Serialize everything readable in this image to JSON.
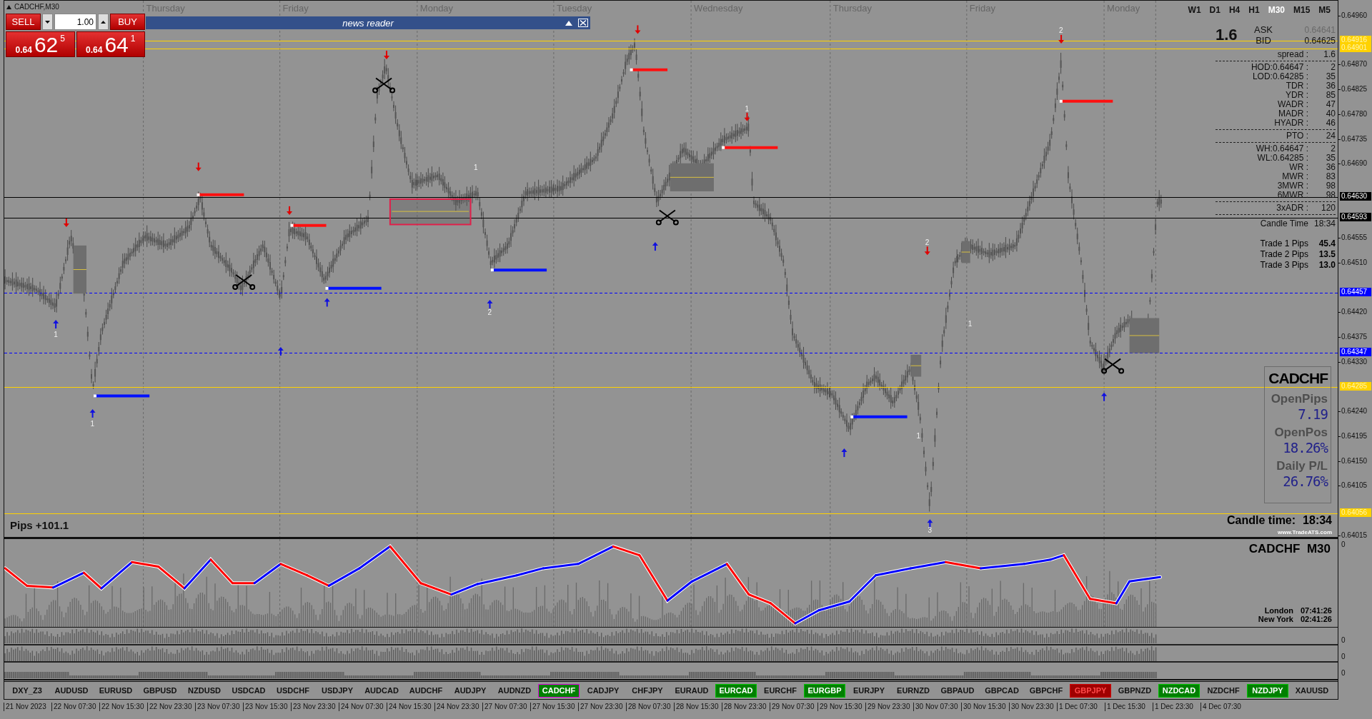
{
  "chart_header": {
    "title": "CADCHF,M30"
  },
  "trade_panel": {
    "sell_label": "SELL",
    "buy_label": "BUY",
    "lot_size": "1.00",
    "sell_price": {
      "prefix": "0.64",
      "big": "62",
      "small": "5"
    },
    "buy_price": {
      "prefix": "0.64",
      "big": "64",
      "small": "1"
    }
  },
  "news_reader": {
    "title": "news reader"
  },
  "day_labels": [
    "Thursday",
    "Friday",
    "Monday",
    "Tuesday",
    "Wednesday",
    "Thursday",
    "Friday",
    "Monday"
  ],
  "timeframes": [
    {
      "label": "W1",
      "selected": false
    },
    {
      "label": "D1",
      "selected": false
    },
    {
      "label": "H4",
      "selected": false
    },
    {
      "label": "H1",
      "selected": false
    },
    {
      "label": "M30",
      "selected": true
    },
    {
      "label": "M15",
      "selected": false
    },
    {
      "label": "M5",
      "selected": false
    }
  ],
  "info_panel": {
    "spread_large": "1.6",
    "ask_label": "ASK",
    "ask": "0.64641",
    "bid_label": "BID",
    "bid": "0.64625",
    "rows": [
      {
        "label": "spread :",
        "value": "1.6",
        "divider_after": true
      },
      {
        "label": "HOD:0.64647 :",
        "value": "2",
        "divider_after": false
      },
      {
        "label": "LOD:0.64285 :",
        "value": "35",
        "divider_after": false
      },
      {
        "label": "TDR :",
        "value": "36",
        "divider_after": false
      },
      {
        "label": "YDR :",
        "value": "85",
        "divider_after": false
      },
      {
        "label": "WADR :",
        "value": "47",
        "divider_after": false
      },
      {
        "label": "MADR :",
        "value": "40",
        "divider_after": false
      },
      {
        "label": "HYADR :",
        "value": "46",
        "divider_after": true
      },
      {
        "label": "PTO :",
        "value": "24",
        "divider_after": true
      },
      {
        "label": "WH:0.64647 :",
        "value": "2",
        "divider_after": false
      },
      {
        "label": "WL:0.64285 :",
        "value": "35",
        "divider_after": false
      },
      {
        "label": "WR :",
        "value": "36",
        "divider_after": false
      },
      {
        "label": "MWR :",
        "value": "83",
        "divider_after": false
      },
      {
        "label": "3MWR :",
        "value": "98",
        "divider_after": false
      },
      {
        "label": "6MWR :",
        "value": "98",
        "divider_after": true
      },
      {
        "label": "3xADR :",
        "value": "120",
        "divider_after": true
      },
      {
        "label": "Candle Time",
        "value": "18:34",
        "divider_after": false
      }
    ],
    "trades": [
      {
        "label": "Trade 1 Pips",
        "value": "45.4"
      },
      {
        "label": "Trade 2 Pips",
        "value": "13.5"
      },
      {
        "label": "Trade 3 Pips",
        "value": "13.0"
      }
    ]
  },
  "account_box": {
    "symbol": "CADCHF",
    "items": [
      {
        "label": "OpenPips",
        "value": "7.19"
      },
      {
        "label": "OpenPos",
        "value": "18.26%"
      },
      {
        "label": "Daily P/L",
        "value": "26.76%"
      }
    ]
  },
  "candle_time": {
    "label": "Candle time:",
    "value": "18:34",
    "credit": "www.TradeATS.com"
  },
  "pips_total": "Pips +101.1",
  "marker_labels": [
    "1",
    "1",
    "2",
    "1",
    "1",
    "2",
    "2",
    "1",
    "1",
    "3"
  ],
  "price_axis": [
    {
      "label": "0.64960",
      "kind": "tick"
    },
    {
      "label": "0.64916",
      "kind": "level",
      "color": "#ffd200"
    },
    {
      "label": "0.64901",
      "kind": "level",
      "color": "#ffd200"
    },
    {
      "label": "0.64870",
      "kind": "tick"
    },
    {
      "label": "0.64825",
      "kind": "tick"
    },
    {
      "label": "0.64780",
      "kind": "tick"
    },
    {
      "label": "0.64735",
      "kind": "tick"
    },
    {
      "label": "0.64690",
      "kind": "tick"
    },
    {
      "label": "0.64630",
      "kind": "level",
      "color": "#000000"
    },
    {
      "label": "0.64593",
      "kind": "level",
      "color": "#000000"
    },
    {
      "label": "0.64555",
      "kind": "tick"
    },
    {
      "label": "0.64510",
      "kind": "tick"
    },
    {
      "label": "0.64457",
      "kind": "dashed-level",
      "color": "#0000ff"
    },
    {
      "label": "0.64420",
      "kind": "tick"
    },
    {
      "label": "0.64375",
      "kind": "tick"
    },
    {
      "label": "0.64347",
      "kind": "dashed-level",
      "color": "#0000ff"
    },
    {
      "label": "0.64330",
      "kind": "tick"
    },
    {
      "label": "0.64285",
      "kind": "level",
      "color": "#ffd200"
    },
    {
      "label": "0.64240",
      "kind": "tick"
    },
    {
      "label": "0.64195",
      "kind": "tick"
    },
    {
      "label": "0.64150",
      "kind": "tick"
    },
    {
      "label": "0.64105",
      "kind": "tick"
    },
    {
      "label": "0.64056",
      "kind": "level",
      "color": "#ffd200"
    },
    {
      "label": "0.64015",
      "kind": "tick"
    }
  ],
  "indicator": {
    "title": "CADCHF  M30",
    "clocks": [
      {
        "city": "London",
        "time": "07:41:26"
      },
      {
        "city": "New York",
        "time": "02:41:26"
      }
    ]
  },
  "indicator_axis": [
    "0",
    "0",
    "0",
    "0"
  ],
  "symbols": [
    {
      "label": "DXY_Z3",
      "selected": false
    },
    {
      "label": "AUDUSD",
      "selected": false
    },
    {
      "label": "EURUSD",
      "selected": false
    },
    {
      "label": "GBPUSD",
      "selected": false
    },
    {
      "label": "NZDUSD",
      "selected": false
    },
    {
      "label": "USDCAD",
      "selected": false
    },
    {
      "label": "USDCHF",
      "selected": false
    },
    {
      "label": "USDJPY",
      "selected": false
    },
    {
      "label": "AUDCAD",
      "selected": false
    },
    {
      "label": "AUDCHF",
      "selected": false
    },
    {
      "label": "AUDJPY",
      "selected": false
    },
    {
      "label": "AUDNZD",
      "selected": false
    },
    {
      "label": "CADCHF",
      "selected": true,
      "color": "#008000"
    },
    {
      "label": "CADJPY",
      "selected": false
    },
    {
      "label": "CHFJPY",
      "selected": false
    },
    {
      "label": "EURAUD",
      "selected": false
    },
    {
      "label": "EURCAD",
      "selected": false,
      "color": "#008000"
    },
    {
      "label": "EURCHF",
      "selected": false
    },
    {
      "label": "EURGBP",
      "selected": false,
      "color": "#008000"
    },
    {
      "label": "EURJPY",
      "selected": false
    },
    {
      "label": "EURNZD",
      "selected": false
    },
    {
      "label": "GBPAUD",
      "selected": false
    },
    {
      "label": "GBPCAD",
      "selected": false
    },
    {
      "label": "GBPCHF",
      "selected": false
    },
    {
      "label": "GBPJPY",
      "selected": false,
      "color": "#a00000"
    },
    {
      "label": "GBPNZD",
      "selected": false
    },
    {
      "label": "NZDCAD",
      "selected": false,
      "color": "#008000"
    },
    {
      "label": "NZDCHF",
      "selected": false
    },
    {
      "label": "NZDJPY",
      "selected": false,
      "color": "#008000"
    },
    {
      "label": "XAUUSD",
      "selected": false
    }
  ],
  "time_axis": [
    "21 Nov 2023",
    "22 Nov 07:30",
    "22 Nov 15:30",
    "22 Nov 23:30",
    "23 Nov 07:30",
    "23 Nov 15:30",
    "23 Nov 23:30",
    "24 Nov 07:30",
    "24 Nov 15:30",
    "24 Nov 23:30",
    "27 Nov 07:30",
    "27 Nov 15:30",
    "27 Nov 23:30",
    "28 Nov 07:30",
    "28 Nov 15:30",
    "28 Nov 23:30",
    "29 Nov 07:30",
    "29 Nov 15:30",
    "29 Nov 23:30",
    "30 Nov 07:30",
    "30 Nov 15:30",
    "30 Nov 23:30",
    "1 Dec 07:30",
    "1 Dec 15:30",
    "1 Dec 23:30",
    "4 Dec 07:30"
  ]
}
